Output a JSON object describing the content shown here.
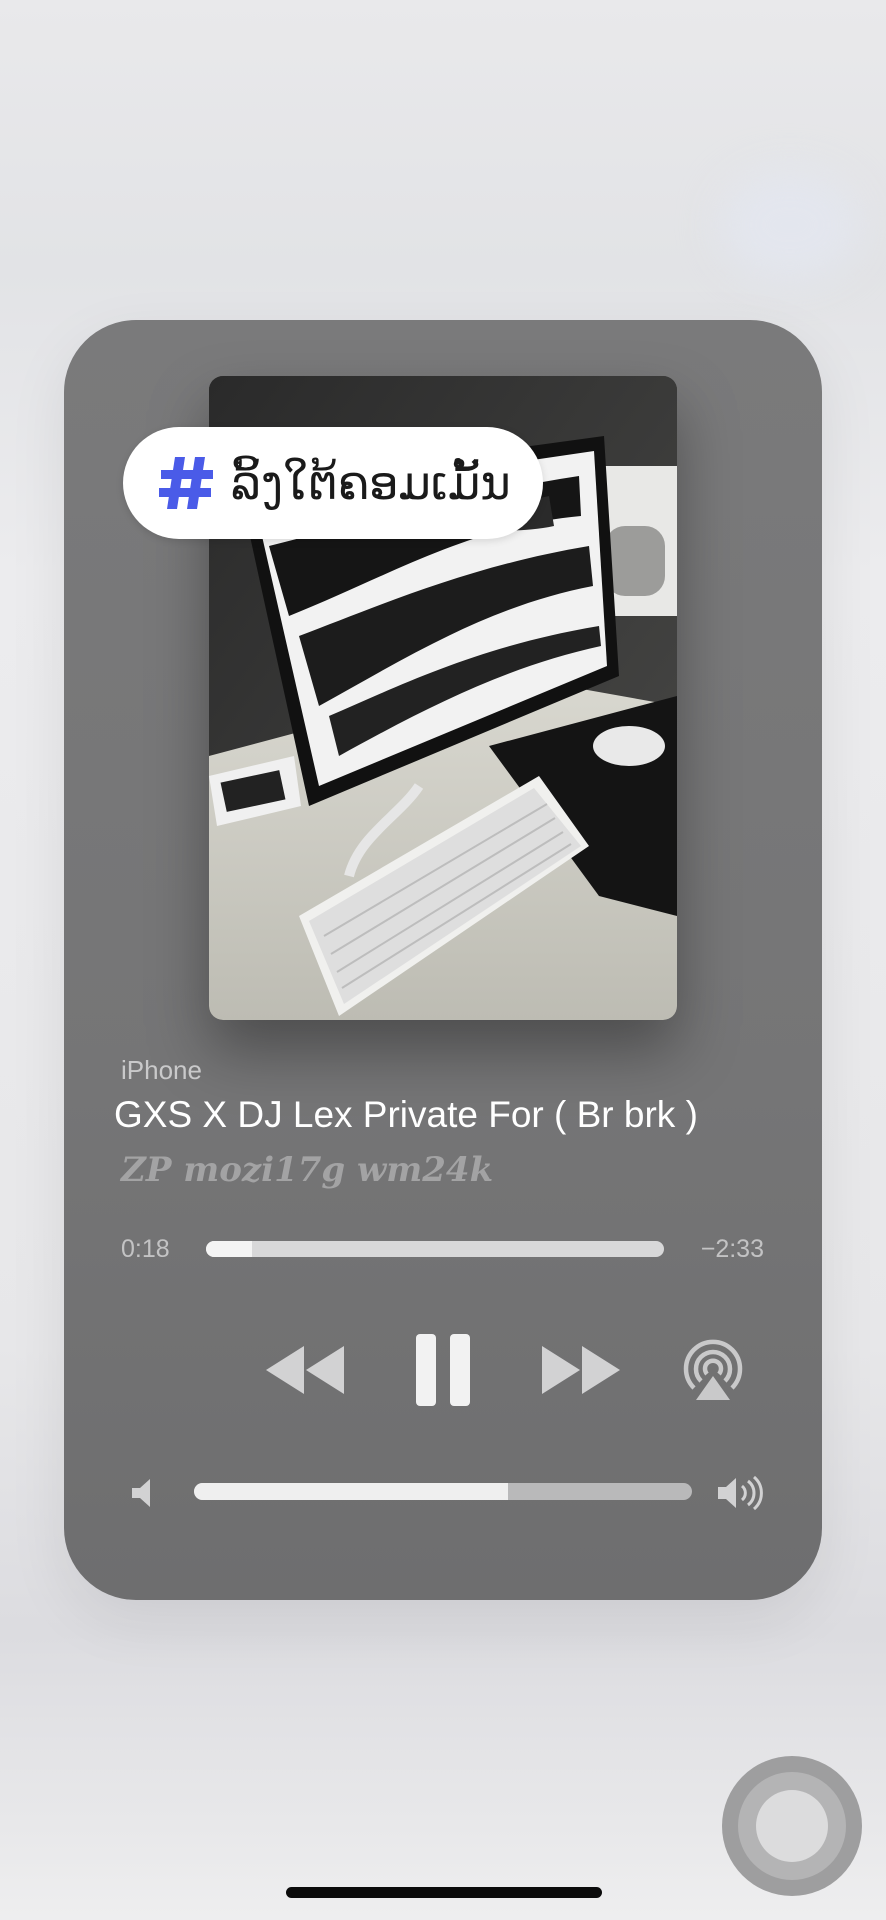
{
  "now_playing": {
    "device": "iPhone",
    "title": "GXS X DJ Lex Private For ( Br brk )",
    "subtitle": "ZP mozi17g wm24k",
    "elapsed": "0:18",
    "remaining": "−2:33",
    "progress_fraction": 0.1,
    "volume_fraction": 0.63
  },
  "sticker": {
    "hash_icon": "hashtag-icon",
    "text": "ລິ້ງໃຕ້ຄອມເມັ້ນ",
    "hash_color": "#4a5be8"
  },
  "controls": {
    "rewind_icon": "rewind-icon",
    "pause_icon": "pause-icon",
    "forward_icon": "fast-forward-icon",
    "airplay_icon": "airplay-icon",
    "volume_min_icon": "speaker-low-icon",
    "volume_max_icon": "speaker-high-icon"
  },
  "colors": {
    "card": "#767677",
    "control": "#d2d2d3",
    "title": "#ffffff"
  }
}
